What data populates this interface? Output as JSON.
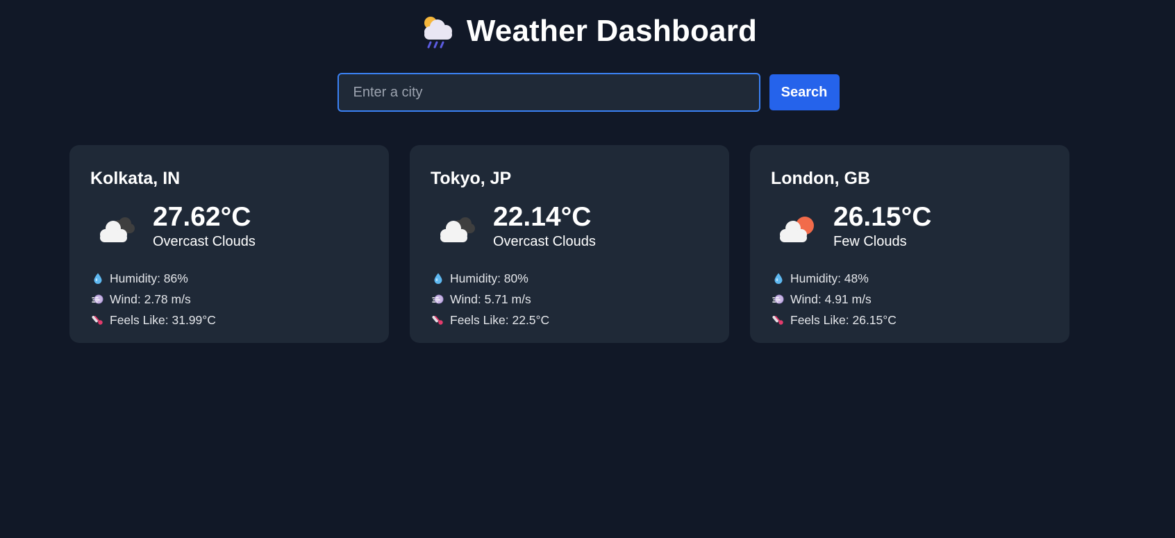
{
  "header": {
    "title": "Weather Dashboard",
    "icon": "cloud-rain-sun-icon"
  },
  "search": {
    "placeholder": "Enter a city",
    "value": "",
    "button_label": "Search"
  },
  "colors": {
    "background": "#111827",
    "card": "#1f2937",
    "accent": "#2563eb",
    "input_border": "#3b82f6"
  },
  "cards": [
    {
      "city": "Kolkata, IN",
      "temp": "27.62°C",
      "description": "Overcast Clouds",
      "icon": "overcast-clouds-icon",
      "humidity": "Humidity: 86%",
      "wind": "Wind: 2.78 m/s",
      "feels_like": "Feels Like: 31.99°C"
    },
    {
      "city": "Tokyo, JP",
      "temp": "22.14°C",
      "description": "Overcast Clouds",
      "icon": "overcast-clouds-icon",
      "humidity": "Humidity: 80%",
      "wind": "Wind: 5.71 m/s",
      "feels_like": "Feels Like: 22.5°C"
    },
    {
      "city": "London, GB",
      "temp": "26.15°C",
      "description": "Few Clouds",
      "icon": "few-clouds-icon",
      "humidity": "Humidity: 48%",
      "wind": "Wind: 4.91 m/s",
      "feels_like": "Feels Like: 26.15°C"
    }
  ]
}
